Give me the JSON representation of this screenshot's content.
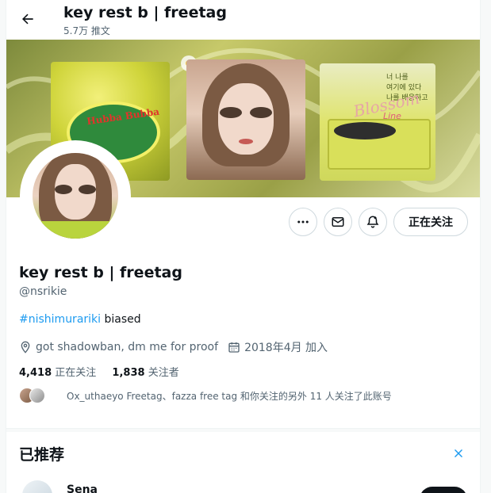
{
  "header": {
    "title": "key rest b | freetag",
    "post_count": "5.7万 推文"
  },
  "banner": {
    "gum_text": "Hubba Bubba",
    "card_text": "너 나를\n여기에 있다\n나를 배웅하고",
    "blossom_text": "Blossom",
    "line_text": "Line"
  },
  "actions": {
    "follow_label": "正在关注"
  },
  "profile": {
    "name": "key rest b | freetag",
    "handle": "@nsrikie",
    "bio_hashtag": "#nishimurariki",
    "bio_rest": " biased",
    "location": "got shadowban, dm me for proof",
    "joined": "2018年4月 加入",
    "following_count": "4,418",
    "following_label": "正在关注",
    "followers_count": "1,838",
    "followers_label": "关注者",
    "mutual_text": "Ox_uthaeyo Freetag、fazza free tag 和你关注的另外 11 人关注了此账号"
  },
  "recommended": {
    "title": "已推荐",
    "first_user": "Sena"
  },
  "colors": {
    "accent": "#1d9bf0",
    "text_primary": "#0f1419",
    "text_secondary": "#536471"
  }
}
